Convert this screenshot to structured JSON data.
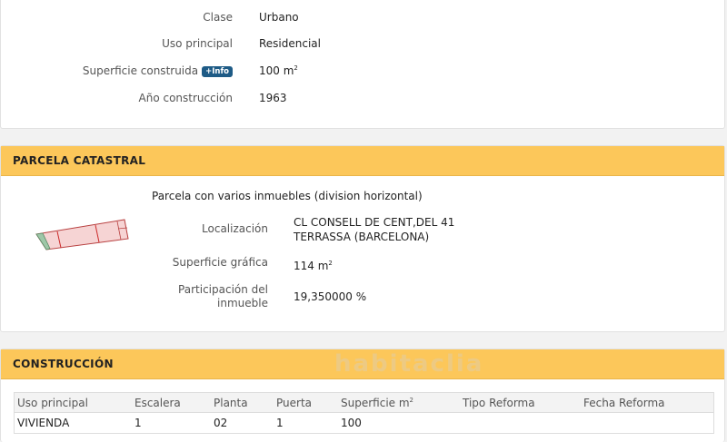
{
  "inmueble": {
    "clase_label": "Clase",
    "clase_value": "Urbano",
    "uso_label": "Uso principal",
    "uso_value": "Residencial",
    "superficie_label": "Superficie construida",
    "info_badge": "+Info",
    "superficie_value": "100 m",
    "superficie_unit_exp": "2",
    "ano_label": "Año construcción",
    "ano_value": "1963"
  },
  "parcela": {
    "header": "PARCELA CATASTRAL",
    "subtitle": "Parcela con varios inmuebles (division horizontal)",
    "localizacion_label": "Localización",
    "localizacion_line1": "CL CONSELL DE CENT,DEL 41",
    "localizacion_line2": "TERRASSA (BARCELONA)",
    "sup_grafica_label": "Superficie gráfica",
    "sup_grafica_value": "114 m",
    "sup_grafica_exp": "2",
    "participacion_label_1": "Participación del",
    "participacion_label_2": "inmueble",
    "participacion_value": "19,350000 %"
  },
  "construccion": {
    "header": "CONSTRUCCIÓN",
    "columns": [
      "Uso principal",
      "Escalera",
      "Planta",
      "Puerta",
      "Superficie m",
      "Tipo Reforma",
      "Fecha Reforma"
    ],
    "superficie_exp": "2",
    "rows": [
      [
        "VIVIENDA",
        "1",
        "02",
        "1",
        "100",
        "",
        ""
      ]
    ]
  },
  "watermark": "habitaclia"
}
